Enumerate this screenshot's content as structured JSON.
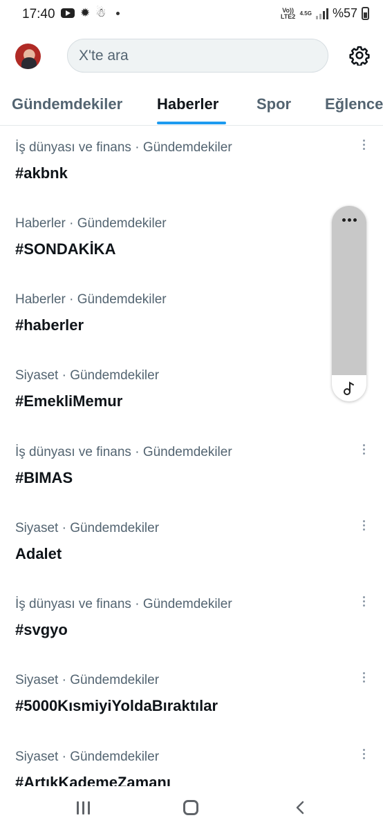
{
  "status_bar": {
    "time": "17:40",
    "volte": "Vo)) LTE2",
    "network": "4.5G",
    "battery_text": "%57",
    "icons": [
      "youtube-icon",
      "settings-sun-icon",
      "app-notification-icon",
      "dot-icon",
      "signal-icon",
      "battery-icon"
    ]
  },
  "header": {
    "search_placeholder": "X'te ara",
    "icons": [
      "avatar",
      "gear-icon"
    ]
  },
  "tabs": [
    {
      "label": "Gündemdekiler",
      "active": false
    },
    {
      "label": "Haberler",
      "active": true
    },
    {
      "label": "Spor",
      "active": false
    },
    {
      "label": "Eğlence",
      "active": false
    }
  ],
  "colors": {
    "accent": "#1d9bf0",
    "secondary_text": "#536471",
    "primary_text": "#0f1419"
  },
  "trends": [
    {
      "meta": "İş dünyası ve finans · Gündemdekiler",
      "name": "#akbnk"
    },
    {
      "meta": "Haberler · Gündemdekiler",
      "name": "#SONDAKİKA"
    },
    {
      "meta": "Haberler · Gündemdekiler",
      "name": "#haberler"
    },
    {
      "meta": "Siyaset · Gündemdekiler",
      "name": "#EmekliMemur"
    },
    {
      "meta": "İş dünyası ve finans · Gündemdekiler",
      "name": "#BIMAS"
    },
    {
      "meta": "Siyaset · Gündemdekiler",
      "name": "Adalet"
    },
    {
      "meta": "İş dünyası ve finans · Gündemdekiler",
      "name": "#svgyo"
    },
    {
      "meta": "Siyaset · Gündemdekiler",
      "name": "#5000KısmiyiYoldaBıraktılar"
    },
    {
      "meta": "Siyaset · Gündemdekiler",
      "name": "#ArtıkKademeZamanı"
    }
  ],
  "floating_widget": {
    "icons": [
      "more-horizontal-icon",
      "music-note-icon"
    ]
  },
  "nav_bar": {
    "icons": [
      "recent-apps-icon",
      "home-icon",
      "back-icon"
    ]
  }
}
